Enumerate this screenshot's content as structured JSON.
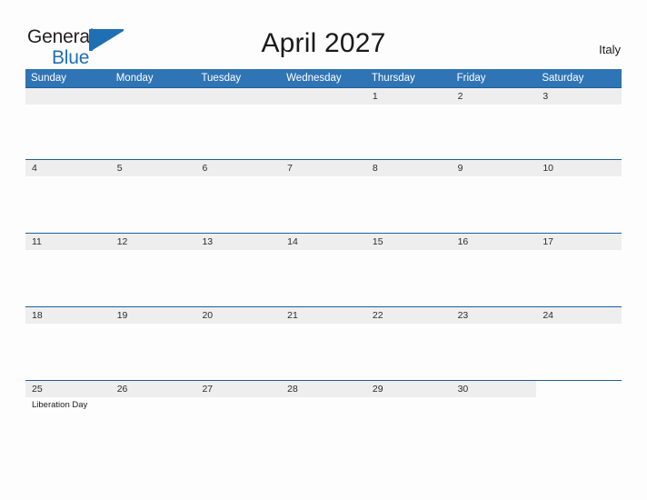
{
  "brand": {
    "name_part1": "General",
    "name_part2": "Blue",
    "accent_color": "#1f6fb5",
    "triangle_icon": "triangle-flag-icon"
  },
  "header": {
    "title": "April 2027",
    "country": "Italy"
  },
  "calendar": {
    "header_bg": "#2f74b5",
    "row_border_color": "#1f6098",
    "band_bg": "#eeeeee",
    "weekdays": [
      "Sunday",
      "Monday",
      "Tuesday",
      "Wednesday",
      "Thursday",
      "Friday",
      "Saturday"
    ],
    "weeks": [
      {
        "days": [
          {
            "number": "",
            "filled": true,
            "event": ""
          },
          {
            "number": "",
            "filled": true,
            "event": ""
          },
          {
            "number": "",
            "filled": true,
            "event": ""
          },
          {
            "number": "",
            "filled": true,
            "event": ""
          },
          {
            "number": "1",
            "filled": true,
            "event": ""
          },
          {
            "number": "2",
            "filled": true,
            "event": ""
          },
          {
            "number": "3",
            "filled": true,
            "event": ""
          }
        ]
      },
      {
        "days": [
          {
            "number": "4",
            "filled": true,
            "event": ""
          },
          {
            "number": "5",
            "filled": true,
            "event": ""
          },
          {
            "number": "6",
            "filled": true,
            "event": ""
          },
          {
            "number": "7",
            "filled": true,
            "event": ""
          },
          {
            "number": "8",
            "filled": true,
            "event": ""
          },
          {
            "number": "9",
            "filled": true,
            "event": ""
          },
          {
            "number": "10",
            "filled": true,
            "event": ""
          }
        ]
      },
      {
        "days": [
          {
            "number": "11",
            "filled": true,
            "event": ""
          },
          {
            "number": "12",
            "filled": true,
            "event": ""
          },
          {
            "number": "13",
            "filled": true,
            "event": ""
          },
          {
            "number": "14",
            "filled": true,
            "event": ""
          },
          {
            "number": "15",
            "filled": true,
            "event": ""
          },
          {
            "number": "16",
            "filled": true,
            "event": ""
          },
          {
            "number": "17",
            "filled": true,
            "event": ""
          }
        ]
      },
      {
        "days": [
          {
            "number": "18",
            "filled": true,
            "event": ""
          },
          {
            "number": "19",
            "filled": true,
            "event": ""
          },
          {
            "number": "20",
            "filled": true,
            "event": ""
          },
          {
            "number": "21",
            "filled": true,
            "event": ""
          },
          {
            "number": "22",
            "filled": true,
            "event": ""
          },
          {
            "number": "23",
            "filled": true,
            "event": ""
          },
          {
            "number": "24",
            "filled": true,
            "event": ""
          }
        ]
      },
      {
        "days": [
          {
            "number": "25",
            "filled": true,
            "event": "Liberation Day"
          },
          {
            "number": "26",
            "filled": true,
            "event": ""
          },
          {
            "number": "27",
            "filled": true,
            "event": ""
          },
          {
            "number": "28",
            "filled": true,
            "event": ""
          },
          {
            "number": "29",
            "filled": true,
            "event": ""
          },
          {
            "number": "30",
            "filled": true,
            "event": ""
          },
          {
            "number": "",
            "filled": false,
            "event": ""
          }
        ]
      }
    ]
  }
}
